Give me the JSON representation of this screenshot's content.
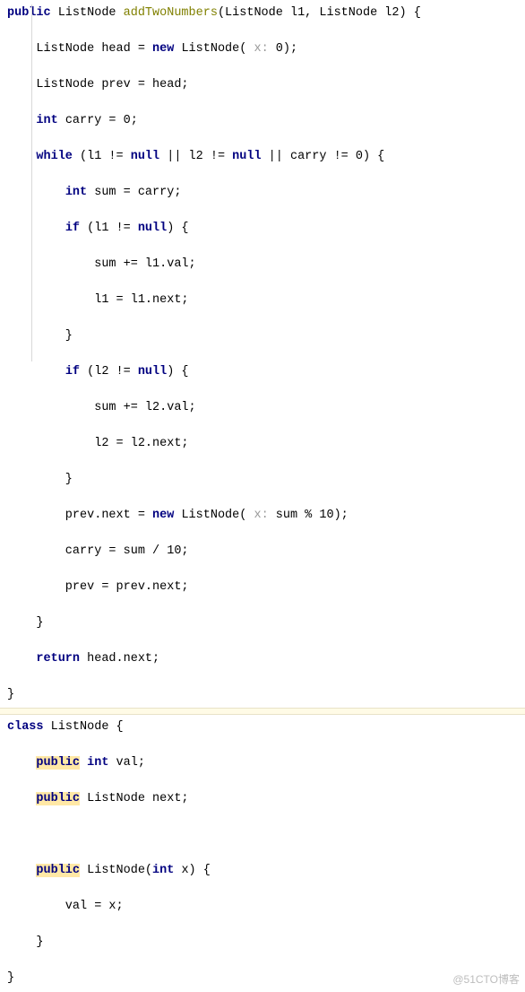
{
  "code1": {
    "l0": {
      "kw1": "public",
      "t1": " ListNode ",
      "m": "addTwoNumbers",
      "t2": "(ListNode l1, ListNode l2) {"
    },
    "l1": {
      "t1": "    ListNode head = ",
      "kw": "new",
      "t2": " ListNode( ",
      "hint": "x:",
      "t3": " 0);"
    },
    "l2": {
      "t1": "    ListNode prev = head;"
    },
    "l3": {
      "t1": "    ",
      "kw": "int",
      "t2": " carry = 0;"
    },
    "l4": {
      "t1": "    ",
      "kw1": "while",
      "t2": " (l1 != ",
      "kw2": "null",
      "t3": " || l2 != ",
      "kw3": "null",
      "t4": " || carry != 0) {"
    },
    "l5": {
      "t1": "        ",
      "kw": "int",
      "t2": " sum = carry;"
    },
    "l6": {
      "t1": "        ",
      "kw1": "if",
      "t2": " (l1 != ",
      "kw2": "null",
      "t3": ") {"
    },
    "l7": {
      "t1": "            sum += l1.val;"
    },
    "l8": {
      "t1": "            l1 = l1.next;"
    },
    "l9": {
      "t1": "        }"
    },
    "l10": {
      "t1": "        ",
      "kw1": "if",
      "t2": " (l2 != ",
      "kw2": "null",
      "t3": ") {"
    },
    "l11": {
      "t1": "            sum += l2.val;"
    },
    "l12": {
      "t1": "            l2 = l2.next;"
    },
    "l13": {
      "t1": "        }"
    },
    "l14": {
      "t1": "        prev.next = ",
      "kw": "new",
      "t2": " ListNode( ",
      "hint": "x:",
      "t3": " sum % 10);"
    },
    "l15": {
      "t1": "        carry = sum / 10;"
    },
    "l16": {
      "t1": "        prev = prev.next;"
    },
    "l17": {
      "t1": "    }"
    },
    "l18": {
      "t1": "    ",
      "kw": "return",
      "t2": " head.next;"
    },
    "l19": {
      "t1": "}"
    }
  },
  "code2": {
    "l0": {
      "kw": "class",
      "t1": " ListNode {"
    },
    "l1": {
      "t1": "    ",
      "kw": "public",
      "t2": " ",
      "kw2": "int",
      "t3": " val;"
    },
    "l2": {
      "t1": "    ",
      "kw": "public",
      "t2": " ListNode next;"
    },
    "blank": " ",
    "l3": {
      "t1": "    ",
      "kw": "public",
      "t2": " ListNode(",
      "kw2": "int",
      "t3": " x) {"
    },
    "l4": {
      "t1": "        val = x;"
    },
    "l5": {
      "t1": "    }"
    },
    "l6": {
      "t1": "}"
    }
  },
  "watermark": "@51CTO博客"
}
